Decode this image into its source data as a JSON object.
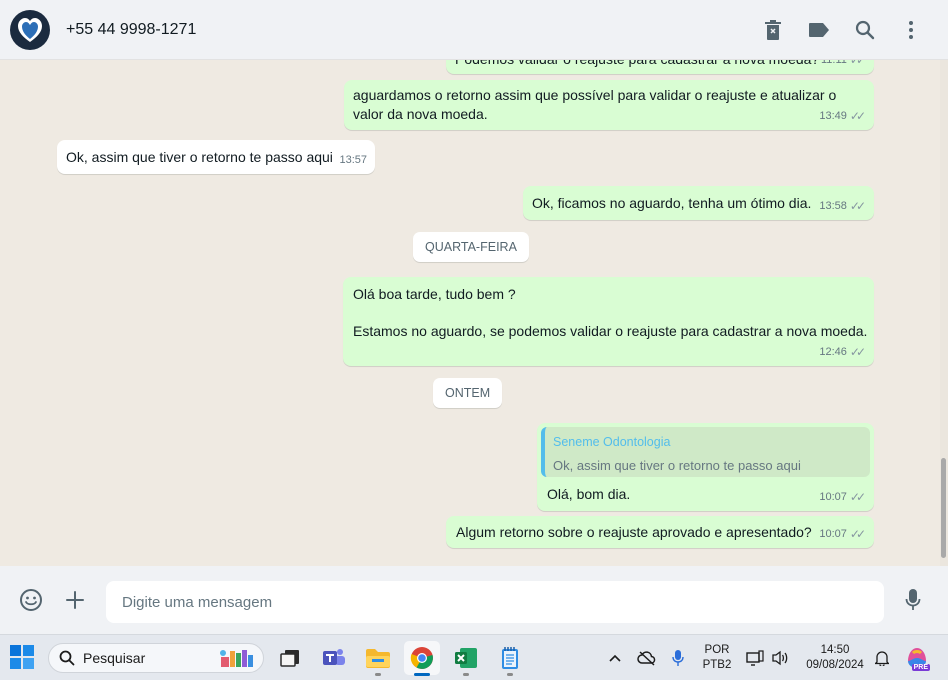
{
  "header": {
    "contact": "+55 44 9998-1271",
    "icons": [
      "trash-icon",
      "label-icon",
      "search-icon",
      "menu-icon"
    ]
  },
  "messages": [
    {
      "text": "Podemos validar o reajuste para cadastrar a nova moeda?",
      "time": "11:11"
    },
    {
      "text1": "aguardamos o retorno assim que possível para validar o reajuste e atualizar o",
      "text2": "valor da nova moeda.",
      "time": "13:49"
    },
    {
      "text": "Ok, assim que tiver o retorno te passo aqui",
      "time": "13:57"
    },
    {
      "text": "Ok, ficamos no aguardo, tenha um ótimo dia.",
      "time": "13:58"
    },
    {
      "text1": "Olá boa tarde, tudo bem ?",
      "text2": "Estamos no aguardo, se podemos validar o reajuste para cadastrar a nova moeda.",
      "time": "12:46"
    },
    {
      "quote_author": "Seneme Odontologia",
      "quote_text": "Ok, assim que tiver o retorno te passo aqui",
      "text": "Olá, bom dia.",
      "time": "10:07"
    },
    {
      "text": "Algum retorno sobre o reajuste aprovado e apresentado?",
      "time": "10:07"
    }
  ],
  "days": [
    "QUARTA-FEIRA",
    "ONTEM"
  ],
  "composer": {
    "placeholder": "Digite uma mensagem"
  },
  "taskbar": {
    "search": "Pesquisar",
    "lang1": "POR",
    "lang2": "PTB2",
    "time": "14:50",
    "date": "09/08/2024",
    "copilot_badge": "PRE"
  },
  "colors": {
    "outgoing": "#d9fdd3",
    "incoming": "#ffffff",
    "background": "#efeae2",
    "quote_accent": "#53bdeb"
  }
}
